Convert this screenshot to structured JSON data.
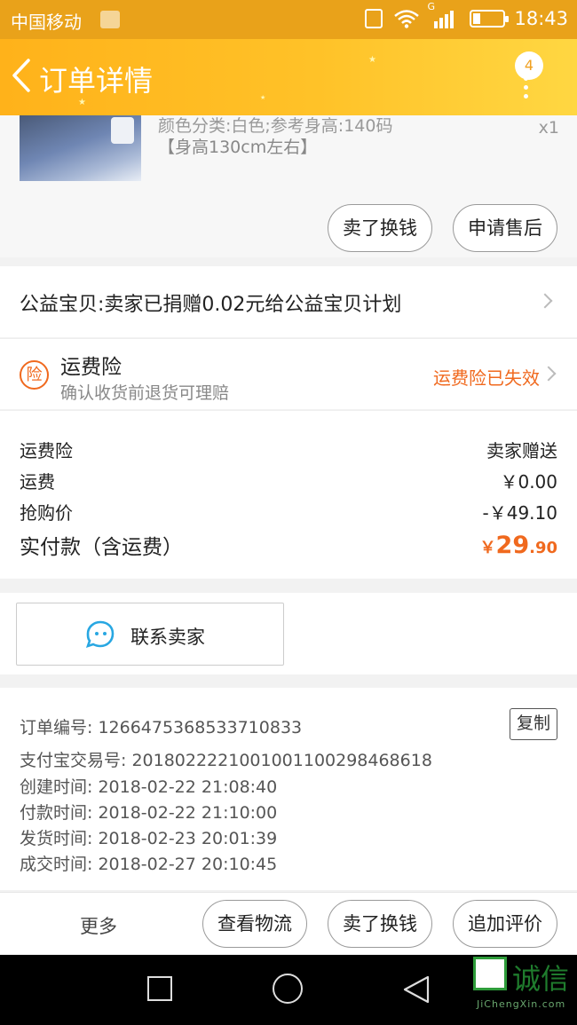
{
  "status_bar": {
    "carrier": "中国移动",
    "network": "G",
    "time": "18:43",
    "battery_level": 0.25
  },
  "navbar": {
    "title": "订单详情",
    "badge_count": "4",
    "accent": "#ffb21a"
  },
  "product": {
    "spec": "颜色分类:白色;参考身高:140码",
    "height_note": "【身高130cm左右】",
    "quantity": "x1",
    "buttons": [
      "卖了换钱",
      "申请售后"
    ]
  },
  "charity": {
    "text": "公益宝贝:卖家已捐赠0.02元给公益宝贝计划"
  },
  "insurance": {
    "badge": "险",
    "title": "运费险",
    "subtitle": "确认收货前退货可理赔",
    "status": "运费险已失效",
    "status_color": "#f0691e"
  },
  "costs": {
    "rows": [
      {
        "label": "运费险",
        "value": "卖家赠送"
      },
      {
        "label": "运费",
        "value": "￥0.00"
      },
      {
        "label": "抢购价",
        "value": "-￥49.10"
      }
    ],
    "total_label": "实付款（含运费）",
    "total_currency": "￥",
    "total_main": "29",
    "total_decimal": ".90"
  },
  "contact": {
    "label": "联系卖家"
  },
  "order_info": {
    "copy_label": "复制",
    "rows": [
      "订单编号: 1266475368533710833",
      "支付宝交易号: 2018022221001001100298468618",
      "创建时间: 2018-02-22 21:08:40",
      "付款时间: 2018-02-22 21:10:00",
      "发货时间: 2018-02-23 20:01:39",
      "成交时间: 2018-02-27 20:10:45"
    ]
  },
  "bottom_bar": {
    "more_label": "更多",
    "buttons": [
      "查看物流",
      "卖了换钱",
      "追加评价"
    ]
  },
  "watermark": {
    "text": "诚信",
    "sub": "JiChengXin.com"
  }
}
